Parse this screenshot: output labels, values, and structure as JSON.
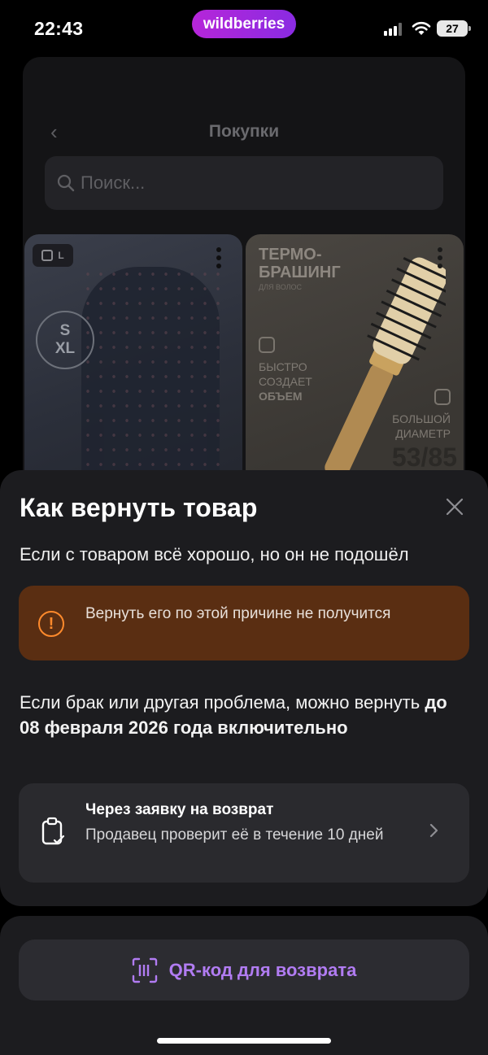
{
  "status_bar": {
    "time": "22:43",
    "brand": "wildberries",
    "battery": "27"
  },
  "background": {
    "title": "Покупки",
    "search_placeholder": "Поиск...",
    "card1": {
      "tag": "L",
      "size_top": "S",
      "size_bottom": "XL"
    },
    "card2": {
      "title_line1": "ТЕРМО-",
      "title_line2": "БРАШИНГ",
      "subtitle": "ДЛЯ ВОЛОС",
      "feature1_line1": "БЫСТРО",
      "feature1_line2": "СОЗДАЕТ",
      "feature1_line3": "ОБЪЕМ",
      "feature2_line1": "БОЛЬШОЙ",
      "feature2_line2": "ДИАМЕТР",
      "number": "53/85"
    }
  },
  "sheet": {
    "title": "Как вернуть товар",
    "subtitle": "Если с товаром всё хорошо, но он не подошёл",
    "warning": "Вернуть его по этой причине не получится",
    "para_prefix": "Если брак или другая проблема, можно вернуть ",
    "para_bold": "до 08 февраля 2026 года включительно",
    "option": {
      "title": "Через заявку на возврат",
      "description": "Продавец проверит её в течение 10 дней"
    }
  },
  "bottom": {
    "qr_label": "QR-код для возврата"
  },
  "colors": {
    "accent": "#b17cf2",
    "warning_bg": "#5a2e12",
    "warning_icon": "#ff8a2c",
    "sheet_bg": "#1c1c1f"
  }
}
